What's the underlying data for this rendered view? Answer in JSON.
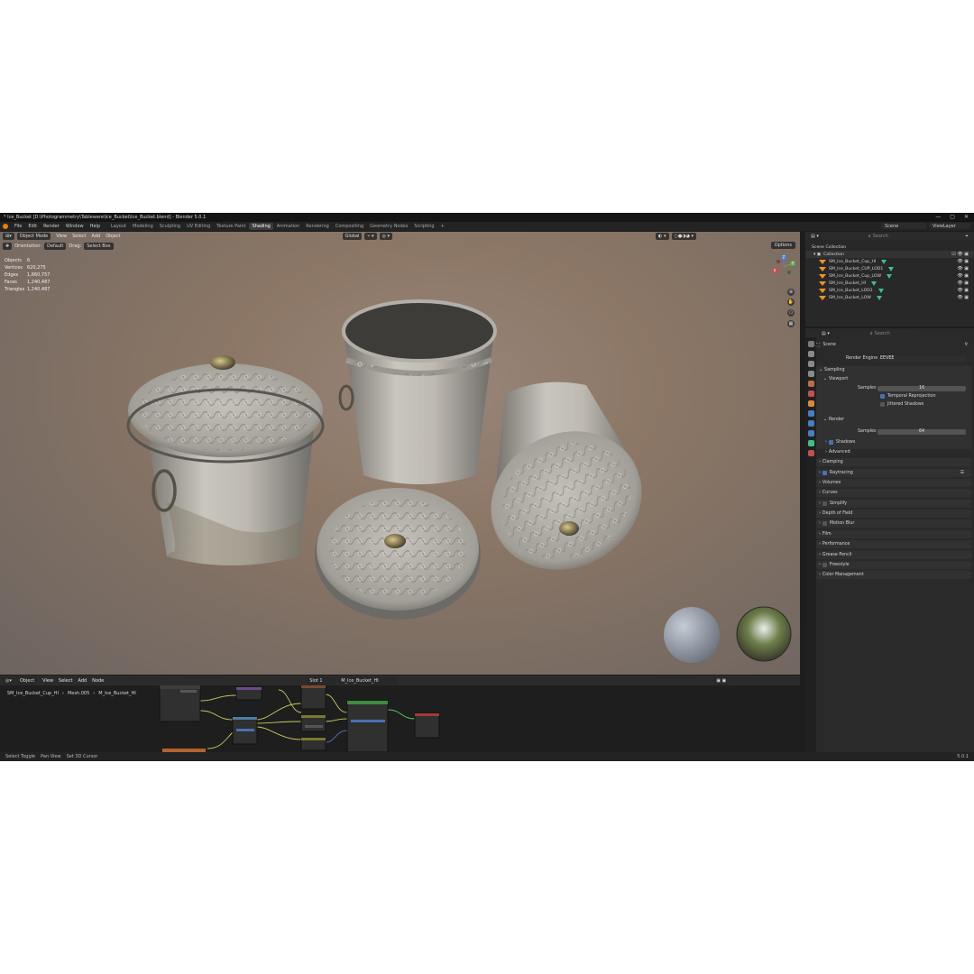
{
  "window": {
    "title": "* Ice_Bucket [D:\\Photogrammetry\\Tableware\\Ice_Bucket\\Ice_Bucket.blend] - Blender 5.0.1",
    "controls": [
      "—",
      "▢",
      "✕"
    ]
  },
  "menu": [
    "File",
    "Edit",
    "Render",
    "Window",
    "Help"
  ],
  "workspaces": [
    "Layout",
    "Modeling",
    "Sculpting",
    "UV Editing",
    "Texture Paint",
    "Shading",
    "Animation",
    "Rendering",
    "Compositing",
    "Geometry Nodes",
    "Scripting"
  ],
  "active_workspace": "Shading",
  "scene": {
    "label": "Scene",
    "viewlayer": "ViewLayer"
  },
  "viewport": {
    "mode": "Object Mode",
    "menus": [
      "View",
      "Select",
      "Add",
      "Object"
    ],
    "orientation_label": "Orientation:",
    "orientation_value": "Default",
    "drag_label": "Drag:",
    "drag_value": "Select Box",
    "transform": "Global",
    "options": "Options",
    "stats": [
      {
        "k": "Objects",
        "v": "6"
      },
      {
        "k": "Vertices",
        "v": "620,275"
      },
      {
        "k": "Edges",
        "v": "1,860,757"
      },
      {
        "k": "Faces",
        "v": "1,240,487"
      },
      {
        "k": "Triangles",
        "v": "1,240,487"
      }
    ],
    "gizmo_axes": [
      "Z",
      "Y",
      "X"
    ]
  },
  "node_editor": {
    "type": "Object",
    "menus": [
      "View",
      "Select",
      "Add",
      "Node"
    ],
    "slot": "Slot 1",
    "material": "M_Ice_Bucket_HI",
    "breadcrumb": [
      "SM_Ice_Bucket_Cup_HI",
      "Mesh.005",
      "M_Ice_Bucket_HI"
    ]
  },
  "statusbar": {
    "items": [
      "Select Toggle",
      "Pan View",
      "Set 3D Cursor"
    ],
    "version": "5.0.1"
  },
  "outliner": {
    "search_placeholder": "Search",
    "root": "Scene Collection",
    "collection": "Collection",
    "items": [
      "SM_Ice_Bucket_Cup_HI",
      "SM_Ice_Bucket_CUP_LOD1",
      "SM_Ice_Bucket_Cup_LOW",
      "SM_Ice_Bucket_HI",
      "SM_Ice_Bucket_LOD1",
      "SM_Ice_Bucket_LOW"
    ]
  },
  "properties": {
    "search_placeholder": "Search",
    "context": "Scene",
    "render_engine_label": "Render Engine",
    "render_engine": "EEVEE",
    "sampling": "Sampling",
    "viewport": "Viewport",
    "samples_label": "Samples",
    "viewport_samples": "16",
    "temporal_reprojection": "Temporal Reprojection",
    "jittered_shadows": "Jittered Shadows",
    "render": "Render",
    "render_samples": "64",
    "shadows": "Shadows",
    "advanced": "Advanced",
    "panels": [
      "Clamping",
      "Raytracing",
      "Volumes",
      "Curves",
      "Simplify",
      "Depth of Field",
      "Motion Blur",
      "Film",
      "Performance",
      "Grease Pencil",
      "Freestyle",
      "Color Management"
    ]
  }
}
